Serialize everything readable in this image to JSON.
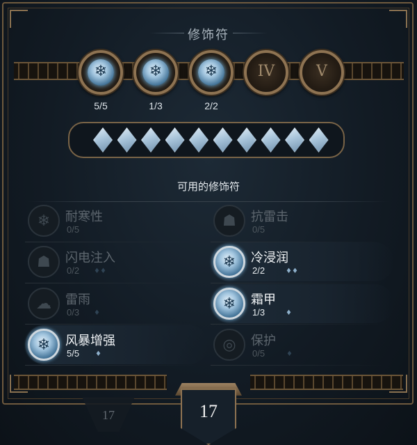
{
  "panel": {
    "title": "修饰符",
    "subtitle": "可用的修饰符"
  },
  "slots": [
    {
      "kind": "rune",
      "icon": "snowflake-rune-icon",
      "count": "5/5"
    },
    {
      "kind": "rune",
      "icon": "snowflake-rune-icon",
      "count": "1/3"
    },
    {
      "kind": "rune",
      "icon": "snowflake-rune-icon",
      "count": "2/2"
    },
    {
      "kind": "empty",
      "roman": "IV"
    },
    {
      "kind": "empty",
      "roman": "V"
    }
  ],
  "gem_count": 10,
  "runes": [
    {
      "name": "耐寒性",
      "count": "0/5",
      "cost": "",
      "active": false,
      "icon": "frost-sigil-icon"
    },
    {
      "name": "抗雷击",
      "count": "0/5",
      "cost": "",
      "active": false,
      "icon": "thunder-mask-icon"
    },
    {
      "name": "闪电注入",
      "count": "0/2",
      "cost": "♦♦",
      "active": false,
      "icon": "lightning-mask-icon"
    },
    {
      "name": "冷浸润",
      "count": "2/2",
      "cost": "♦♦",
      "active": true,
      "icon": "snowflake-rune-icon"
    },
    {
      "name": "雷雨",
      "count": "0/3",
      "cost": "♦",
      "active": false,
      "icon": "storm-icon"
    },
    {
      "name": "霜甲",
      "count": "1/3",
      "cost": "♦",
      "active": true,
      "icon": "snowflake-rune-icon"
    },
    {
      "name": "风暴增强",
      "count": "5/5",
      "cost": "♦",
      "active": true,
      "icon": "snowflake-rune-icon"
    },
    {
      "name": "保护",
      "count": "0/5",
      "cost": "♦",
      "active": false,
      "icon": "spiral-shield-icon"
    }
  ],
  "points": {
    "previous": "17",
    "current": "17"
  },
  "colors": {
    "frame_gold": "#8e7352",
    "ice_blue": "#9fc3dd",
    "background": "#121b24"
  }
}
